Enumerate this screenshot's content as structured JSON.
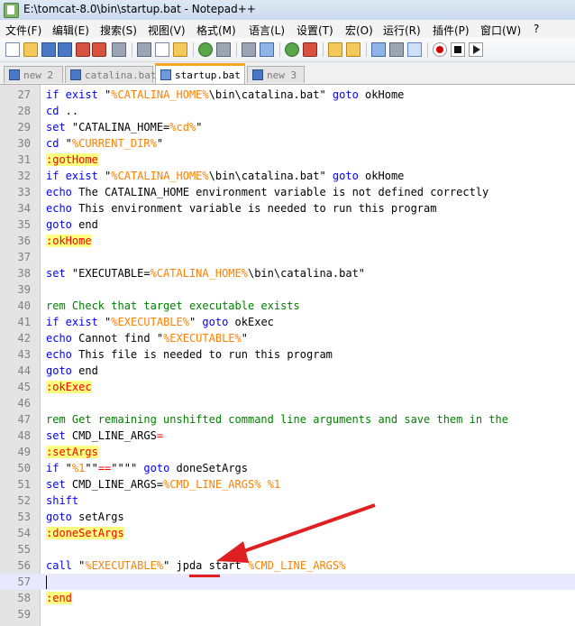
{
  "window": {
    "title": "E:\\tomcat-8.0\\bin\\startup.bat - Notepad++"
  },
  "menu": [
    "文件(F)",
    "编辑(E)",
    "搜索(S)",
    "视图(V)",
    "格式(M)",
    "语言(L)",
    "设置(T)",
    "宏(O)",
    "运行(R)",
    "插件(P)",
    "窗口(W)",
    "?"
  ],
  "toolbar_icons": [
    "new-file",
    "open-folder",
    "save",
    "save-all",
    "close",
    "close-all",
    "print",
    "cut",
    "copy",
    "paste",
    "undo",
    "redo",
    "find",
    "replace",
    "zoom-in",
    "zoom-out",
    "sync-vertical",
    "sync-horizontal",
    "word-wrap",
    "show-all-chars",
    "indent-guide",
    "record-macro",
    "stop-macro",
    "play-macro"
  ],
  "tabs": [
    {
      "label": "new  2",
      "active": false
    },
    {
      "label": "catalina.bat",
      "active": false
    },
    {
      "label": "startup.bat",
      "active": true
    },
    {
      "label": "new  3",
      "active": false
    }
  ],
  "colors": {
    "keyword": "#0000ff",
    "variable": "#ff8000",
    "comment": "#008000",
    "label_text": "#ff0000",
    "label_highlight": "#ffff80",
    "current_line": "#e8e8ff",
    "annotation_arrow": "#e02020"
  },
  "lines": [
    {
      "n": "27",
      "segs": [
        [
          "kw",
          "if exist "
        ],
        [
          "str",
          "\""
        ],
        [
          "var",
          "%CATALINA_HOME%"
        ],
        [
          "str",
          "\\bin\\catalina.bat\" "
        ],
        [
          "kw",
          "goto"
        ],
        [
          "str",
          " okHome"
        ]
      ]
    },
    {
      "n": "28",
      "segs": [
        [
          "kw",
          "cd"
        ],
        [
          "str",
          " .."
        ]
      ]
    },
    {
      "n": "29",
      "segs": [
        [
          "kw",
          "set"
        ],
        [
          "str",
          " \"CATALINA_HOME="
        ],
        [
          "var",
          "%cd%"
        ],
        [
          "str",
          "\""
        ]
      ]
    },
    {
      "n": "30",
      "segs": [
        [
          "kw",
          "cd"
        ],
        [
          "str",
          " \""
        ],
        [
          "var",
          "%CURRENT_DIR%"
        ],
        [
          "str",
          "\""
        ]
      ]
    },
    {
      "n": "31",
      "segs": [
        [
          "lbl",
          ":gotHome"
        ]
      ]
    },
    {
      "n": "32",
      "segs": [
        [
          "kw",
          "if exist "
        ],
        [
          "str",
          "\""
        ],
        [
          "var",
          "%CATALINA_HOME%"
        ],
        [
          "str",
          "\\bin\\catalina.bat\" "
        ],
        [
          "kw",
          "goto"
        ],
        [
          "str",
          " okHome"
        ]
      ]
    },
    {
      "n": "33",
      "segs": [
        [
          "kw",
          "echo"
        ],
        [
          "str",
          " The CATALINA_HOME environment variable is not defined correctly"
        ]
      ]
    },
    {
      "n": "34",
      "segs": [
        [
          "kw",
          "echo"
        ],
        [
          "str",
          " This environment variable is needed to run this program"
        ]
      ]
    },
    {
      "n": "35",
      "segs": [
        [
          "kw",
          "goto"
        ],
        [
          "str",
          " end"
        ]
      ]
    },
    {
      "n": "36",
      "segs": [
        [
          "lbl",
          ":okHome"
        ]
      ]
    },
    {
      "n": "37",
      "segs": []
    },
    {
      "n": "38",
      "segs": [
        [
          "kw",
          "set"
        ],
        [
          "str",
          " \"EXECUTABLE="
        ],
        [
          "var",
          "%CATALINA_HOME%"
        ],
        [
          "str",
          "\\bin\\catalina.bat\""
        ]
      ]
    },
    {
      "n": "39",
      "segs": []
    },
    {
      "n": "40",
      "segs": [
        [
          "cm",
          "rem Check that target executable exists"
        ]
      ]
    },
    {
      "n": "41",
      "segs": [
        [
          "kw",
          "if exist "
        ],
        [
          "str",
          "\""
        ],
        [
          "var",
          "%EXECUTABLE%"
        ],
        [
          "str",
          "\" "
        ],
        [
          "kw",
          "goto"
        ],
        [
          "str",
          " okExec"
        ]
      ]
    },
    {
      "n": "42",
      "segs": [
        [
          "kw",
          "echo"
        ],
        [
          "str",
          " Cannot find \""
        ],
        [
          "var",
          "%EXECUTABLE%"
        ],
        [
          "str",
          "\""
        ]
      ]
    },
    {
      "n": "43",
      "segs": [
        [
          "kw",
          "echo"
        ],
        [
          "str",
          " This file is needed to run this program"
        ]
      ]
    },
    {
      "n": "44",
      "segs": [
        [
          "kw",
          "goto"
        ],
        [
          "str",
          " end"
        ]
      ]
    },
    {
      "n": "45",
      "segs": [
        [
          "lbl",
          ":okExec"
        ]
      ]
    },
    {
      "n": "46",
      "segs": []
    },
    {
      "n": "47",
      "segs": [
        [
          "cm",
          "rem Get remaining unshifted command line arguments and save them in the"
        ]
      ]
    },
    {
      "n": "48",
      "segs": [
        [
          "kw",
          "set"
        ],
        [
          "str",
          " CMD_LINE_ARGS"
        ],
        [
          "op",
          "="
        ]
      ]
    },
    {
      "n": "49",
      "segs": [
        [
          "lbl",
          ":setArgs"
        ]
      ]
    },
    {
      "n": "50",
      "segs": [
        [
          "kw",
          "if"
        ],
        [
          "str",
          " \""
        ],
        [
          "var",
          "%1"
        ],
        [
          "str",
          "\"\""
        ],
        [
          "op",
          "=="
        ],
        [
          "str",
          "\"\"\"\" "
        ],
        [
          "kw",
          "goto"
        ],
        [
          "str",
          " doneSetArgs"
        ]
      ]
    },
    {
      "n": "51",
      "segs": [
        [
          "kw",
          "set"
        ],
        [
          "str",
          " CMD_LINE_ARGS="
        ],
        [
          "var",
          "%CMD_LINE_ARGS%"
        ],
        [
          "str",
          " "
        ],
        [
          "var",
          "%1"
        ]
      ]
    },
    {
      "n": "52",
      "segs": [
        [
          "kw",
          "shift"
        ]
      ]
    },
    {
      "n": "53",
      "segs": [
        [
          "kw",
          "goto"
        ],
        [
          "str",
          " setArgs"
        ]
      ]
    },
    {
      "n": "54",
      "segs": [
        [
          "lbl",
          ":doneSetArgs"
        ]
      ]
    },
    {
      "n": "55",
      "segs": []
    },
    {
      "n": "56",
      "segs": [
        [
          "kw",
          "call"
        ],
        [
          "str",
          " \""
        ],
        [
          "var",
          "%EXECUTABLE%"
        ],
        [
          "str",
          "\" jpda start "
        ],
        [
          "var",
          "%CMD_LINE_ARGS%"
        ]
      ]
    },
    {
      "n": "57",
      "segs": [],
      "current": true
    },
    {
      "n": "58",
      "segs": [
        [
          "lbl",
          ":end"
        ]
      ]
    },
    {
      "n": "59",
      "segs": []
    }
  ]
}
